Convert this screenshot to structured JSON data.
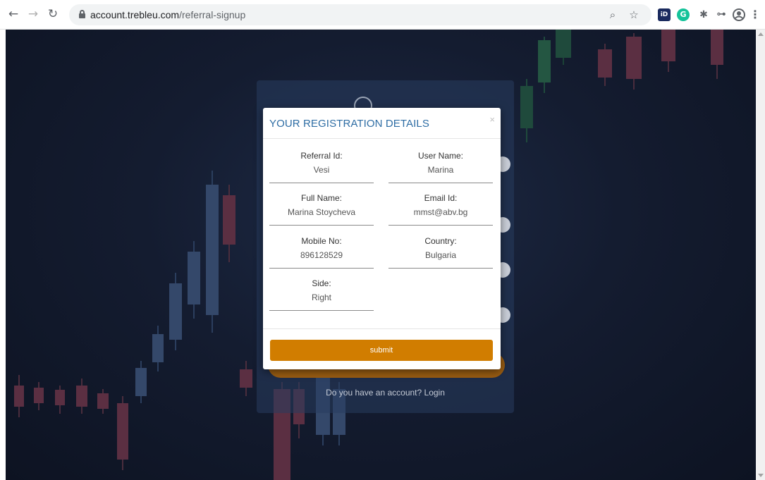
{
  "browser": {
    "url_host": "account.trebleu.com",
    "url_path": "/referral-signup",
    "extensions": [
      "zoom-icon",
      "star-icon",
      "id-extension-icon",
      "grammarly-icon",
      "puzzle-icon",
      "key-icon",
      "profile-icon",
      "menu-icon"
    ]
  },
  "modal": {
    "title": "YOUR REGISTRATION DETAILS",
    "close": "×",
    "fields": [
      {
        "label": "Referral Id:",
        "value": "Vesi"
      },
      {
        "label": "User Name:",
        "value": "Marina"
      },
      {
        "label": "Full Name:",
        "value": "Marina Stoycheva"
      },
      {
        "label": "Email Id:",
        "value": "mmst@abv.bg"
      },
      {
        "label": "Mobile No:",
        "value": "896128529"
      },
      {
        "label": "Country:",
        "value": "Bulgaria"
      },
      {
        "label": "Side:",
        "value": "Right"
      }
    ],
    "submit_label": "submit"
  },
  "background_page": {
    "login_prompt": "Do you have an account? Login"
  },
  "colors": {
    "accent": "#d17d00",
    "title": "#2e6da4",
    "background": "#141c30"
  }
}
